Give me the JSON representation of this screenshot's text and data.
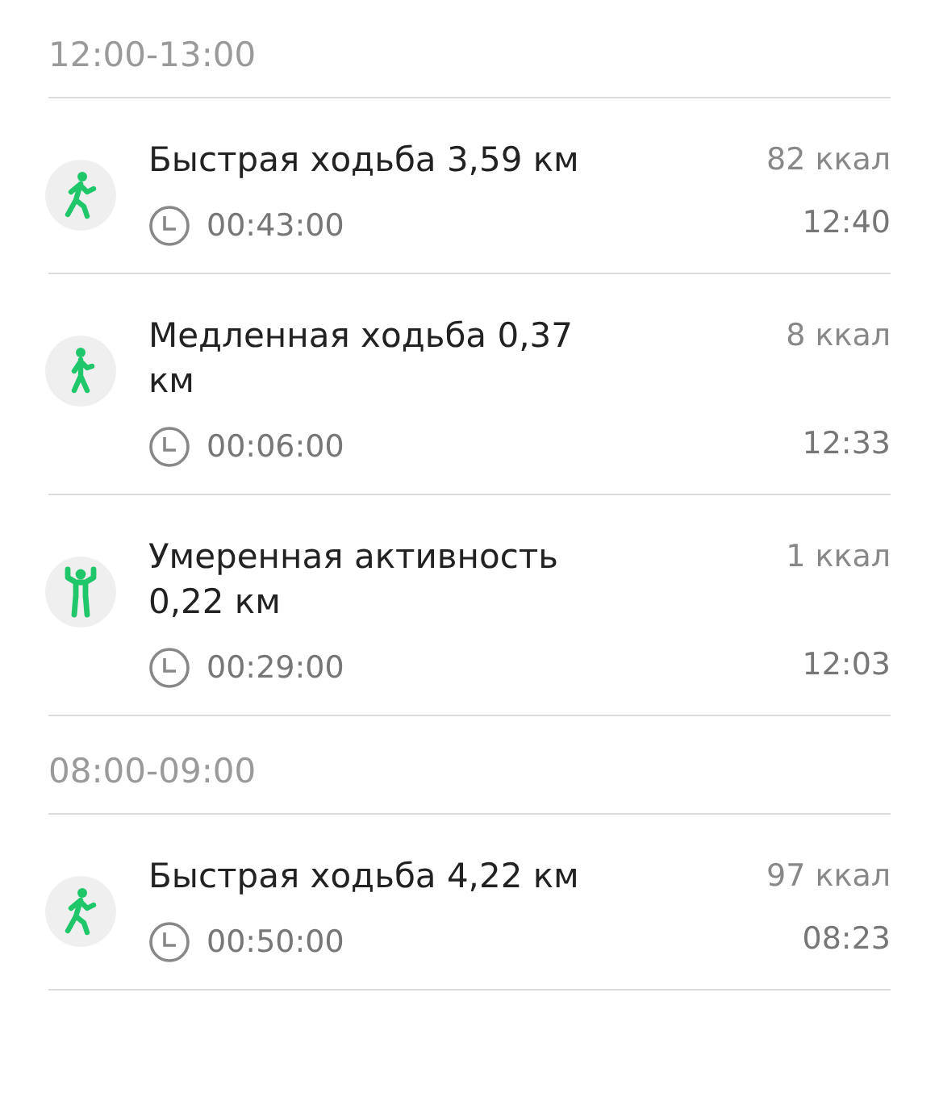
{
  "sections": [
    {
      "header": "12:00-13:00",
      "items": [
        {
          "kind": "fast_walk",
          "title": "Быстрая ходьба 3,59 км",
          "calories": "82 ккал",
          "duration": "00:43:00",
          "time": "12:40"
        },
        {
          "kind": "slow_walk",
          "title": "Медленная ходьба 0,37 км",
          "calories": "8 ккал",
          "duration": "00:06:00",
          "time": "12:33"
        },
        {
          "kind": "moderate",
          "title": "Умеренная активность 0,22 км",
          "calories": "1 ккал",
          "duration": "00:29:00",
          "time": "12:03"
        }
      ]
    },
    {
      "header": "08:00-09:00",
      "items": [
        {
          "kind": "fast_walk",
          "title": "Быстрая ходьба 4,22 км",
          "calories": "97 ккал",
          "duration": "00:50:00",
          "time": "08:23"
        }
      ]
    }
  ]
}
